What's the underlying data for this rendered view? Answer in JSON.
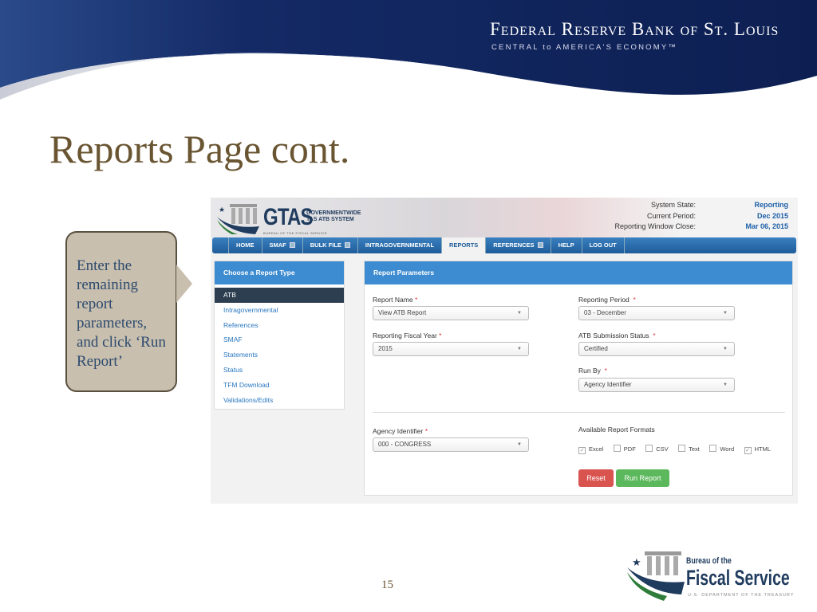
{
  "slide": {
    "title": "Reports Page cont.",
    "page_number": "15",
    "callout": "Enter the remaining report parameters, and click ‘Run Report’",
    "header_logo": {
      "name": "Federal Reserve Bank of St. Louis",
      "tagline": "CENTRAL to AMERICA'S ECONOMY™"
    },
    "footer_logo": {
      "line1": "Bureau of the",
      "line2": "Fiscal Service",
      "line3": "U.S. DEPARTMENT OF THE TREASURY"
    },
    "colors": {
      "navy": "#0d1f52",
      "title": "#6a5532",
      "callout_bg": "#c8bfae"
    }
  },
  "gtas": {
    "logo": {
      "name": "GTAS",
      "subtitle": "GOVERNMENTWIDE TAS ATB SYSTEM",
      "bureau": "BUREAU OF THE FISCAL SERVICE"
    },
    "status": {
      "system_state_label": "System State:",
      "system_state": "Reporting",
      "current_period_label": "Current Period:",
      "current_period": "Dec 2015",
      "window_close_label": "Reporting Window Close:",
      "window_close": "Mar 06, 2015"
    },
    "nav": [
      {
        "label": "HOME"
      },
      {
        "label": "SMAF",
        "dropdown": true
      },
      {
        "label": "BULK FILE",
        "dropdown": true
      },
      {
        "label": "INTRAGOVERNMENTAL"
      },
      {
        "label": "REPORTS",
        "active": true
      },
      {
        "label": "REFERENCES",
        "dropdown": true
      },
      {
        "label": "HELP"
      },
      {
        "label": "LOG OUT"
      }
    ],
    "report_types": {
      "title": "Choose a Report Type",
      "items": [
        "ATB",
        "Intragovernmental",
        "References",
        "SMAF",
        "Statements",
        "Status",
        "TFM Download",
        "Validations/Edits"
      ],
      "selected": "ATB"
    },
    "params": {
      "title": "Report Parameters",
      "report_name": {
        "label": "Report Name",
        "value": "View ATB Report"
      },
      "fiscal_year": {
        "label": "Reporting Fiscal Year",
        "value": "2015"
      },
      "period": {
        "label": "Reporting Period",
        "value": "03 - December"
      },
      "submission_status": {
        "label": "ATB Submission Status",
        "value": "Certified"
      },
      "run_by": {
        "label": "Run By",
        "value": "Agency Identifier"
      },
      "agency": {
        "label": "Agency Identifier",
        "value": "000 - CONGRESS"
      },
      "formats_label": "Available Report Formats",
      "formats": [
        {
          "label": "Excel",
          "checked": true
        },
        {
          "label": "PDF",
          "checked": false
        },
        {
          "label": "CSV",
          "checked": false
        },
        {
          "label": "Text",
          "checked": false
        },
        {
          "label": "Word",
          "checked": false
        },
        {
          "label": "HTML",
          "checked": true
        }
      ],
      "reset": "Reset",
      "run": "Run Report",
      "required_mark": "*"
    }
  }
}
